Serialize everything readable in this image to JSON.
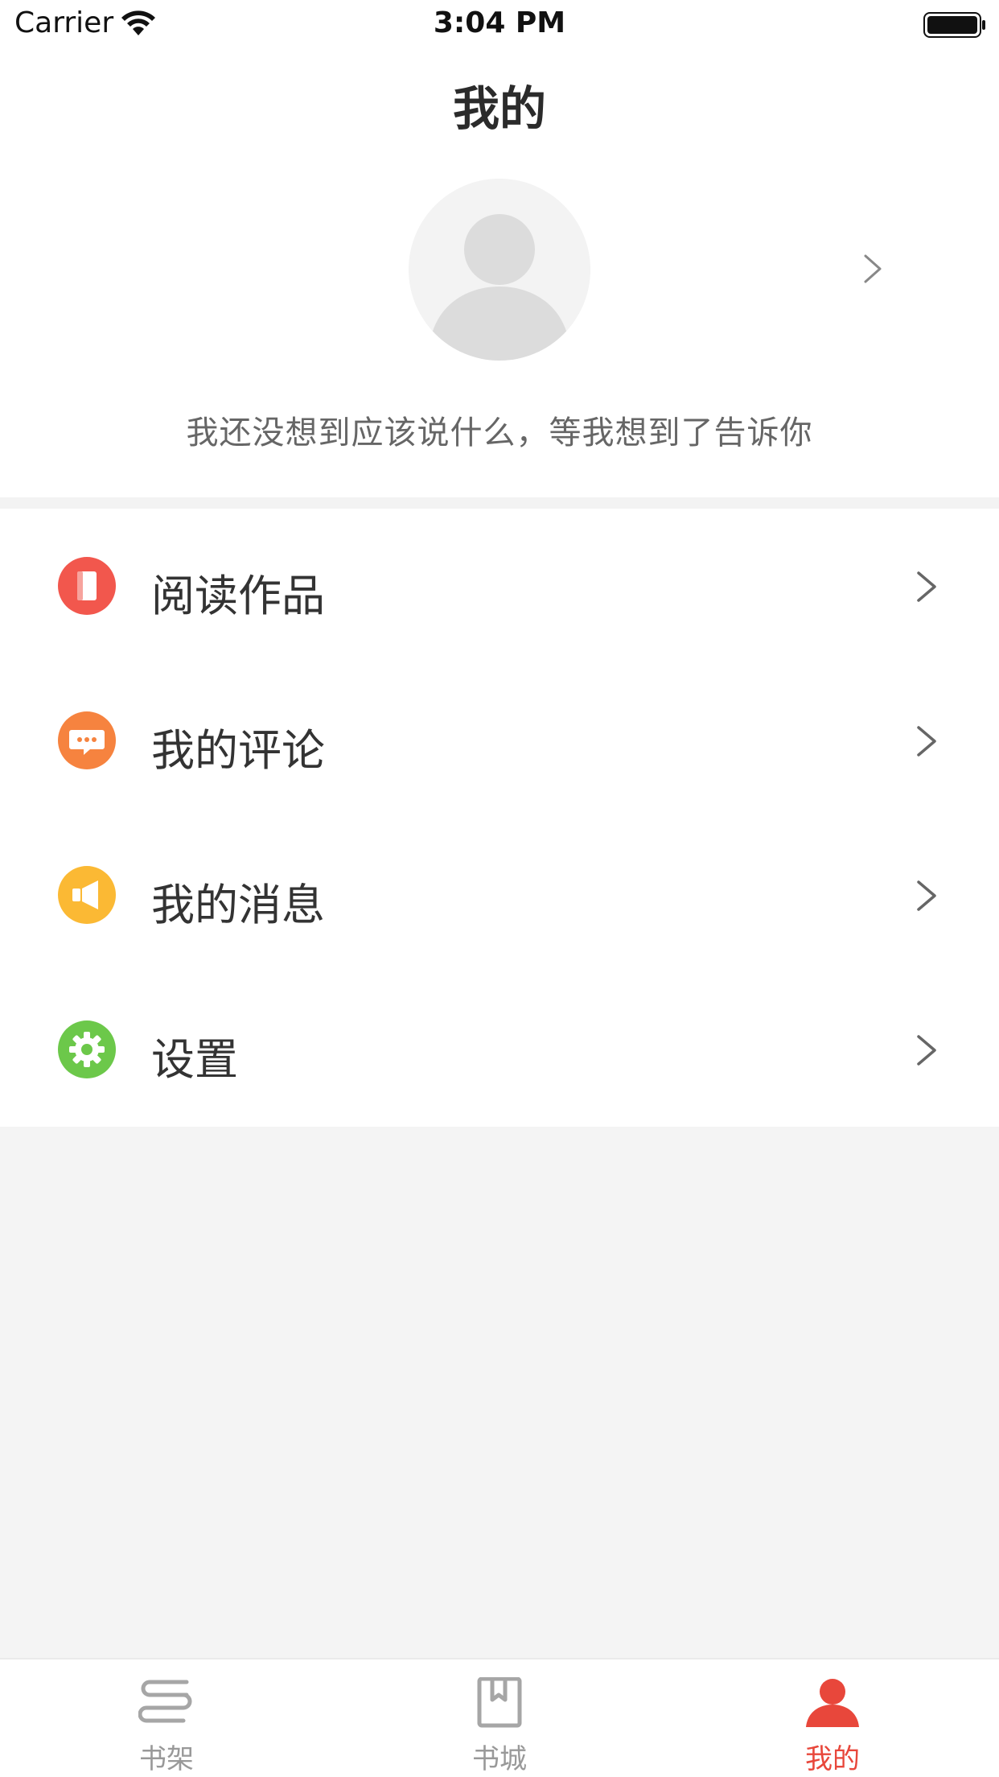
{
  "status_bar": {
    "carrier": "Carrier",
    "time": "3:04 PM"
  },
  "nav": {
    "title": "我的"
  },
  "profile": {
    "signature": "我还没想到应该说什么，等我想到了告诉你"
  },
  "menu": {
    "items": [
      {
        "label": "阅读作品",
        "icon": "book-icon",
        "color": "#f2574d"
      },
      {
        "label": "我的评论",
        "icon": "comment-icon",
        "color": "#f6833f"
      },
      {
        "label": "我的消息",
        "icon": "megaphone-icon",
        "color": "#fbb934"
      },
      {
        "label": "设置",
        "icon": "gear-icon",
        "color": "#6cc84a"
      }
    ]
  },
  "tabbar": {
    "tabs": [
      {
        "label": "书架",
        "icon": "bookshelf-icon",
        "active": false
      },
      {
        "label": "书城",
        "icon": "bookstore-icon",
        "active": false
      },
      {
        "label": "我的",
        "icon": "user-icon",
        "active": true
      }
    ],
    "active_color": "#e8473b",
    "inactive_color": "#999999"
  }
}
